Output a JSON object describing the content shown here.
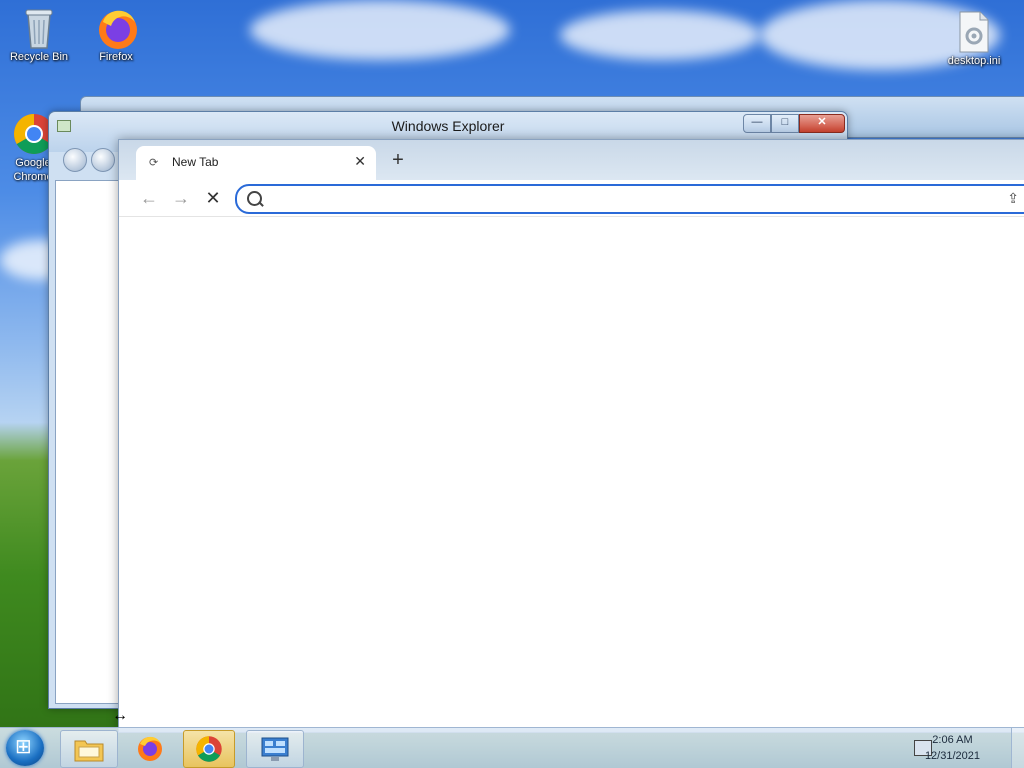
{
  "desktop": {
    "icons": [
      {
        "label": "Recycle Bin"
      },
      {
        "label": "Firefox"
      },
      {
        "label": "Google Chrome"
      },
      {
        "label": "desktop.ini"
      }
    ]
  },
  "explorer_window": {
    "title": "Windows Explorer",
    "minimize_label": "—",
    "maximize_label": "□",
    "close_label": "✕"
  },
  "chrome_window": {
    "tab": {
      "label": "New Tab",
      "close_label": "✕"
    },
    "new_tab_label": "+",
    "toolbar": {
      "back_label": "←",
      "forward_label": "→",
      "stop_label": "✕"
    },
    "omnibox": {
      "value": "",
      "placeholder": ""
    }
  },
  "taskbar": {
    "clock_time": "2:06 AM",
    "clock_date": "12/31/2021",
    "buttons": [
      {
        "name": "file-explorer",
        "active": false
      },
      {
        "name": "firefox",
        "active": false
      },
      {
        "name": "chrome",
        "active": true
      },
      {
        "name": "control-panel",
        "active": false
      }
    ]
  },
  "colors": {
    "omnibox_focus": "#2a6ad8",
    "close_button": "#c7422f",
    "taskbar_active": "#e8c45e"
  }
}
